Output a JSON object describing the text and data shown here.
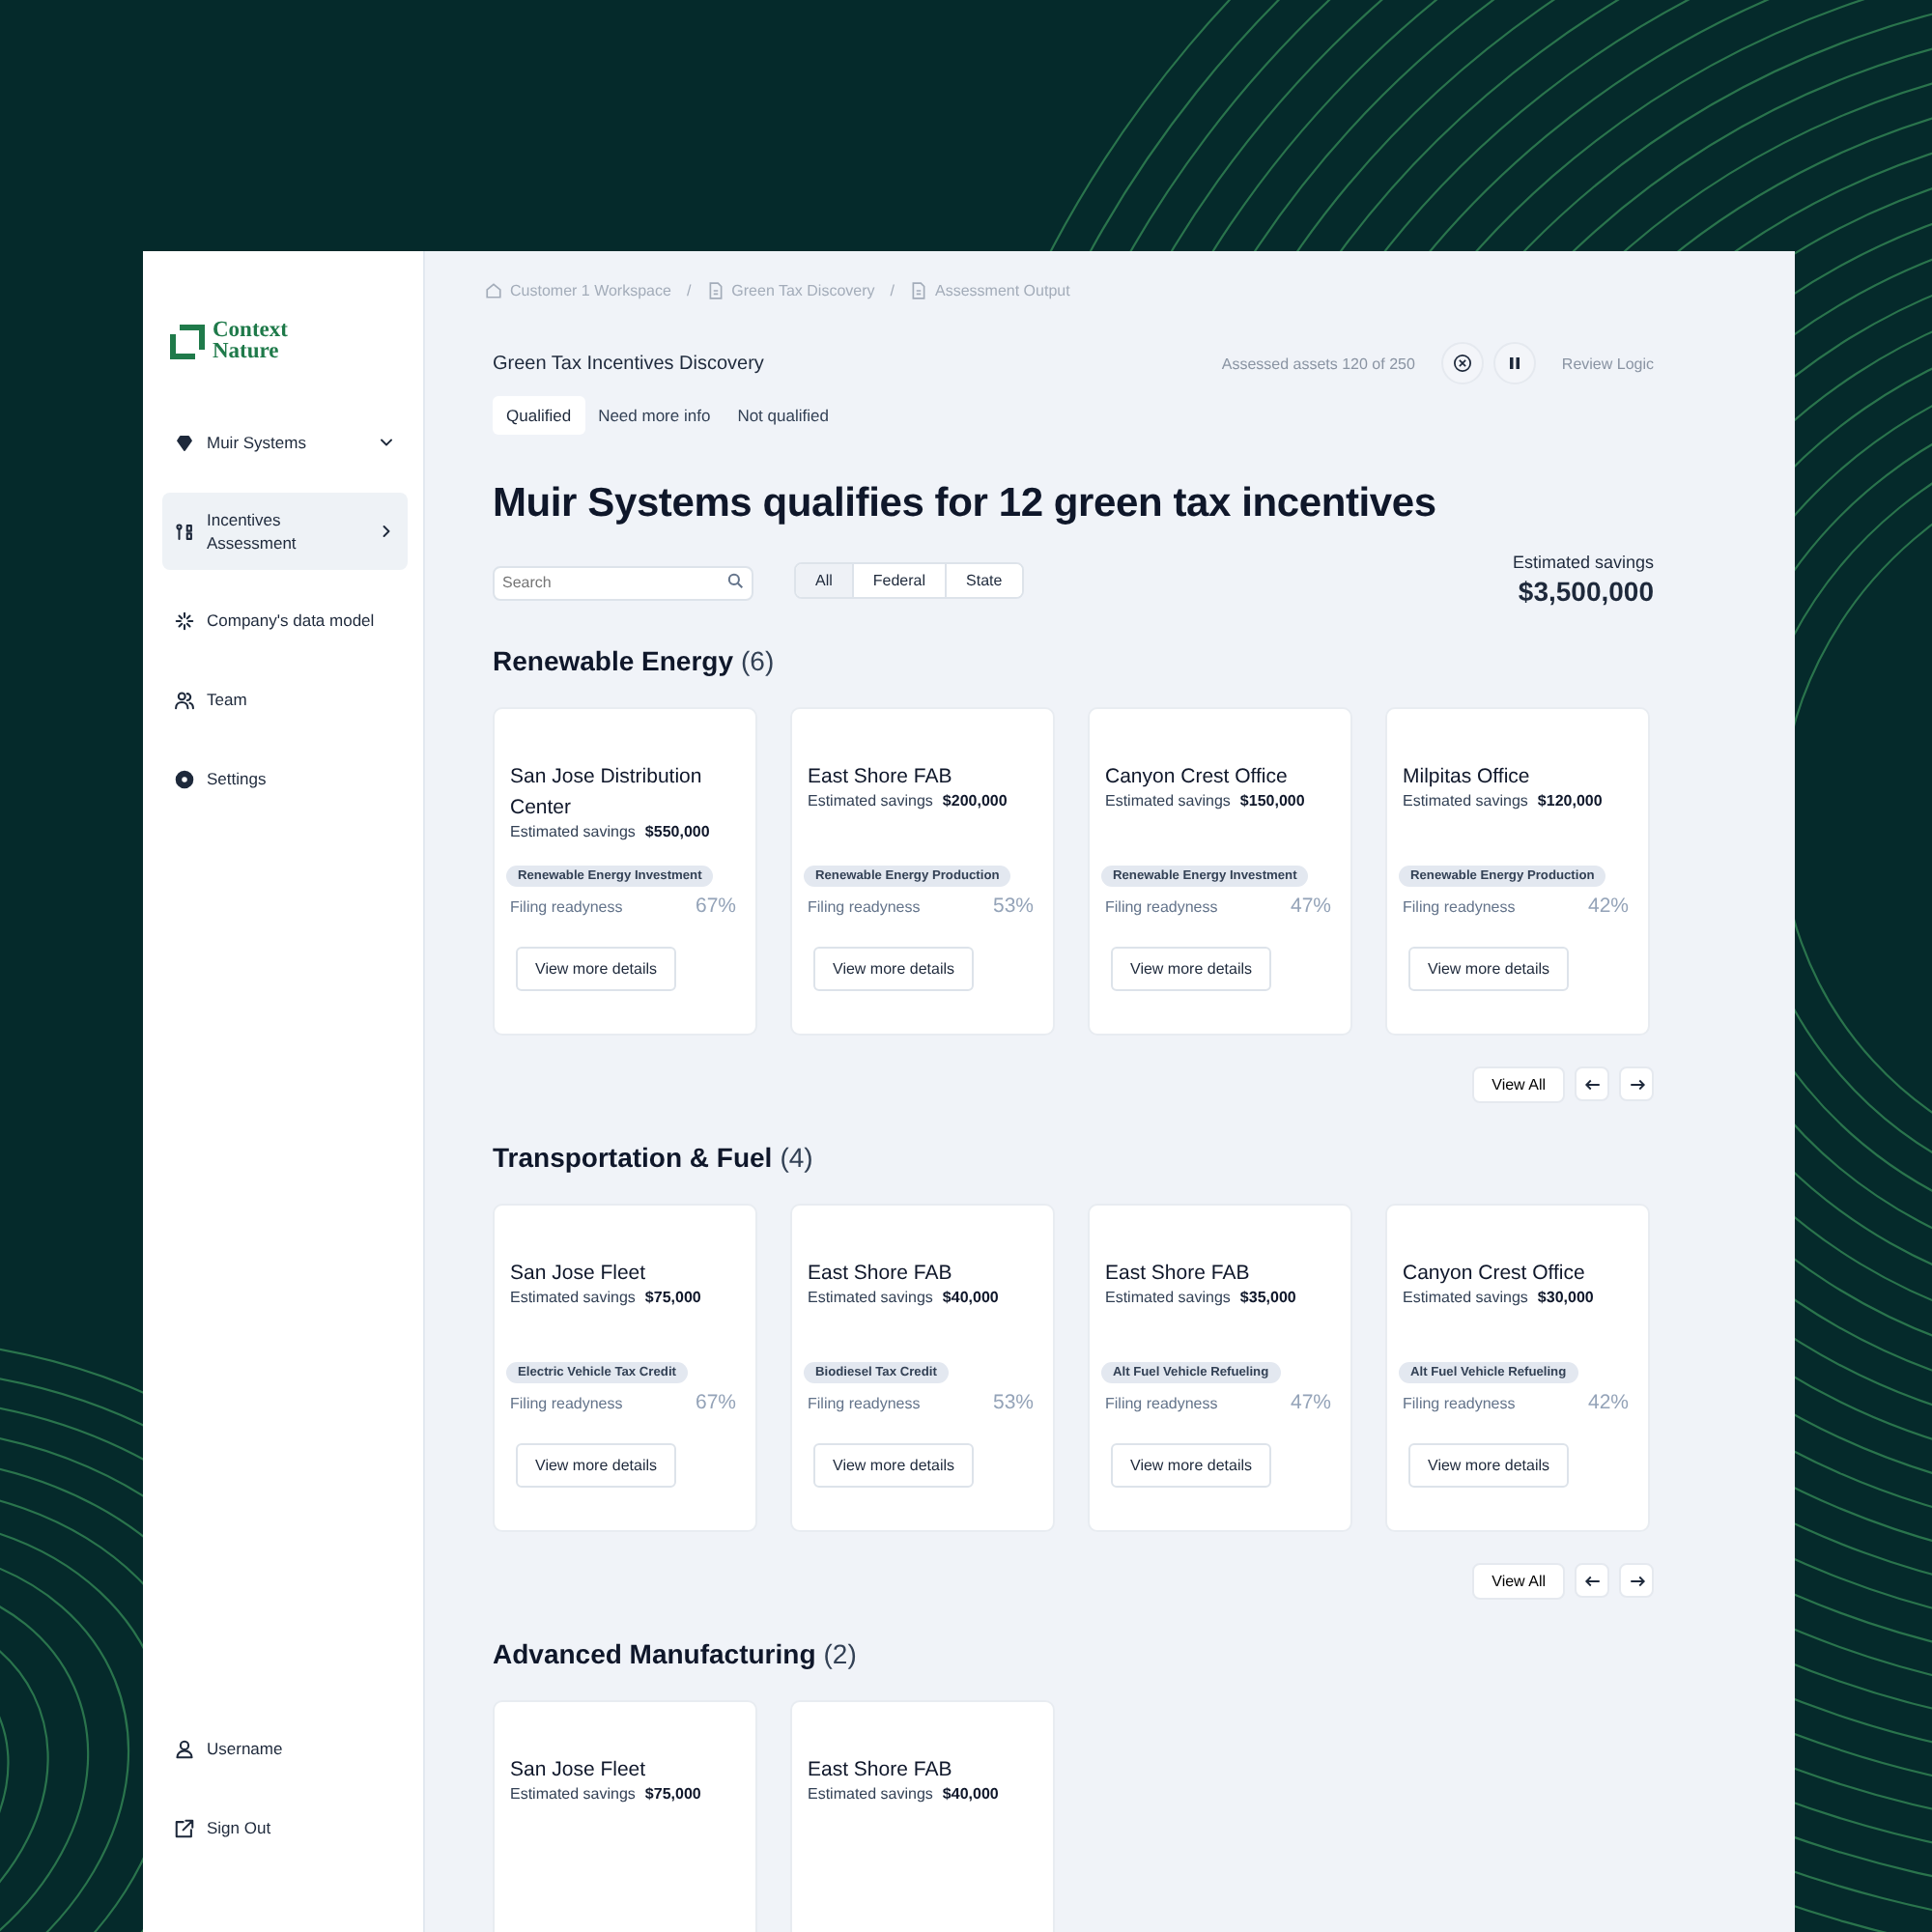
{
  "brand": {
    "lines": [
      "Context",
      "Nature"
    ]
  },
  "sidebar": {
    "items": [
      {
        "label": "Muir Systems",
        "selected": false,
        "expanded": true
      },
      {
        "label": "Incentives Assessment",
        "selected": true,
        "expanded": false
      },
      {
        "label": "Company's data model",
        "selected": false
      },
      {
        "label": "Team",
        "selected": false
      },
      {
        "label": "Settings",
        "selected": false
      }
    ],
    "footer": [
      "Username",
      "Sign Out"
    ]
  },
  "breadcrumb": [
    {
      "label": "Customer 1 Workspace"
    },
    {
      "separator": "/",
      "label": "Green Tax Discovery"
    },
    {
      "separator": "/",
      "label": "Assessment Output"
    }
  ],
  "header": {
    "title": "Green Tax Incentives Discovery",
    "progress": "Assessed assets 120 of 250",
    "review": "Review Logic"
  },
  "tabs": [
    {
      "label": "Qualified",
      "selected": true
    },
    {
      "label": "Need more info",
      "selected": false
    },
    {
      "label": "Not qualified",
      "selected": false
    }
  ],
  "headline": "Muir Systems qualifies for 12 green tax incentives",
  "search": {
    "placeholder": "Search"
  },
  "filters": [
    {
      "label": "All",
      "selected": true
    },
    {
      "label": "Federal",
      "selected": false
    },
    {
      "label": "State",
      "selected": false
    }
  ],
  "savings": {
    "label": "Estimated savings",
    "value": "$3,500,000"
  },
  "sections": [
    {
      "title": "Renewable Energy",
      "count": "(6)",
      "view_all": "View All",
      "cards": [
        {
          "name": "San Jose Distribution Center",
          "savings_label": "Estimated savings",
          "savings": "$550,000",
          "tag": "Renewable Energy Investment",
          "readiness_label": "Filing readyness",
          "readiness": "67%",
          "button": "View more details"
        },
        {
          "name": "East Shore FAB",
          "savings_label": "Estimated savings",
          "savings": "$200,000",
          "tag": "Renewable Energy Production",
          "readiness_label": "Filing readyness",
          "readiness": "53%",
          "button": "View more details"
        },
        {
          "name": "Canyon Crest Office",
          "savings_label": "Estimated savings",
          "savings": "$150,000",
          "tag": "Renewable Energy Investment",
          "readiness_label": "Filing readyness",
          "readiness": "47%",
          "button": "View more details"
        },
        {
          "name": "Milpitas Office",
          "savings_label": "Estimated savings",
          "savings": "$120,000",
          "tag": "Renewable Energy Production",
          "readiness_label": "Filing readyness",
          "readiness": "42%",
          "button": "View more details"
        }
      ]
    },
    {
      "title": "Transportation & Fuel",
      "count": "(4)",
      "view_all": "View All",
      "cards": [
        {
          "name": "San Jose Fleet",
          "savings_label": "Estimated savings",
          "savings": "$75,000",
          "tag": "Electric Vehicle Tax Credit",
          "readiness_label": "Filing readyness",
          "readiness": "67%",
          "button": "View more details"
        },
        {
          "name": "East Shore FAB",
          "savings_label": "Estimated savings",
          "savings": "$40,000",
          "tag": "Biodiesel Tax Credit",
          "readiness_label": "Filing readyness",
          "readiness": "53%",
          "button": "View more details"
        },
        {
          "name": "East Shore FAB",
          "savings_label": "Estimated savings",
          "savings": "$35,000",
          "tag": "Alt Fuel Vehicle Refueling",
          "readiness_label": "Filing readyness",
          "readiness": "47%",
          "button": "View more details"
        },
        {
          "name": "Canyon Crest Office",
          "savings_label": "Estimated savings",
          "savings": "$30,000",
          "tag": "Alt Fuel Vehicle Refueling",
          "readiness_label": "Filing readyness",
          "readiness": "42%",
          "button": "View more details"
        }
      ]
    },
    {
      "title": "Advanced Manufacturing",
      "count": "(2)",
      "cards": [
        {
          "name": "San Jose Fleet",
          "savings_label": "Estimated savings",
          "savings": "$75,000"
        },
        {
          "name": "East Shore FAB",
          "savings_label": "Estimated savings",
          "savings": "$40,000"
        }
      ]
    }
  ]
}
